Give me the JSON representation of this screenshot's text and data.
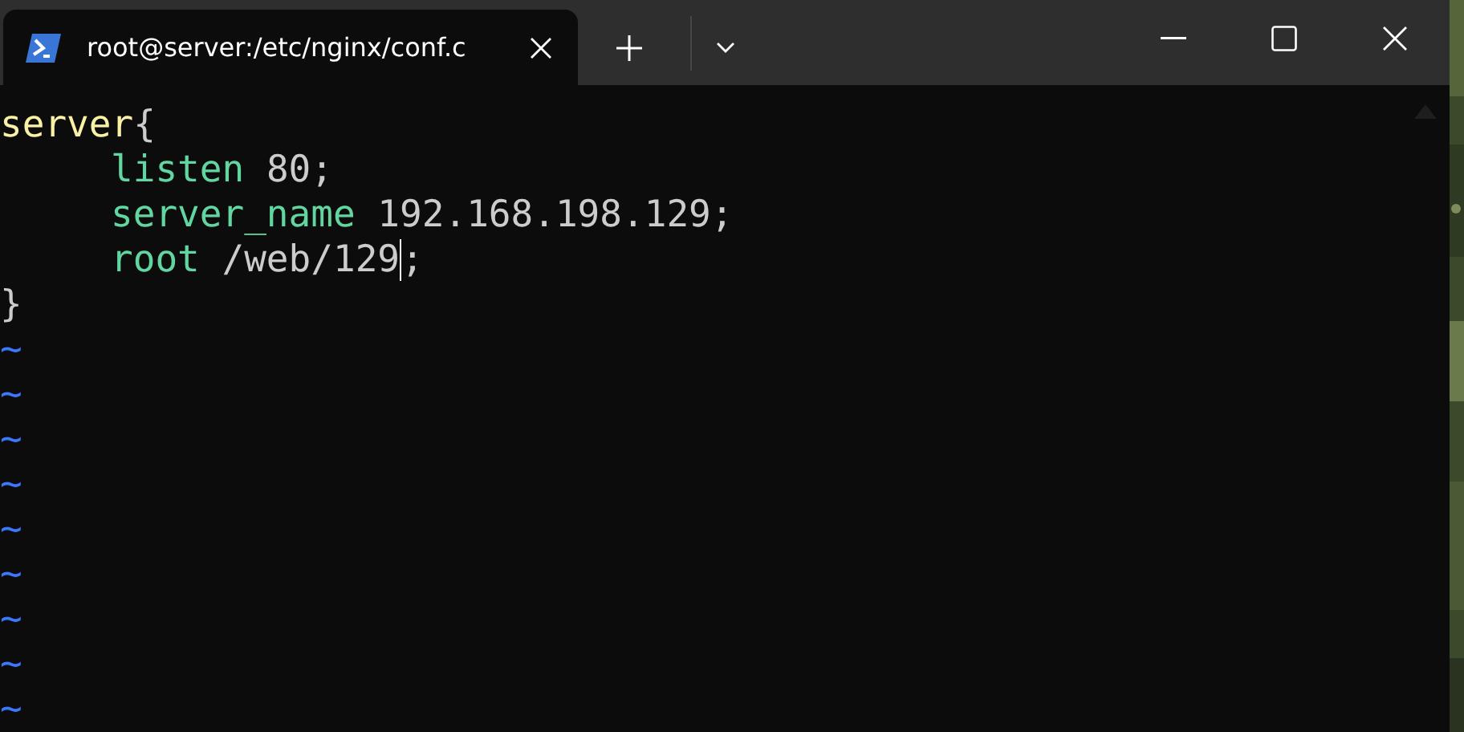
{
  "tab": {
    "title": "root@server:/etc/nginx/conf.c",
    "selected": true
  },
  "editor": {
    "blocks": [
      {
        "name": "server",
        "open": "{",
        "close": "}",
        "children": [
          [
            {
              "kind": "directive",
              "text": "listen"
            },
            {
              "kind": "plain",
              "text": " 80;"
            }
          ],
          [
            {
              "kind": "directive",
              "text": "server_name"
            },
            {
              "kind": "plain",
              "text": " 192.168.198.129;"
            }
          ],
          [
            {
              "kind": "directive",
              "text": "root"
            },
            {
              "kind": "plain",
              "text": " /web/129"
            },
            {
              "kind": "plain",
              "text": ";",
              "cursor": true
            }
          ]
        ]
      }
    ],
    "tildes": [
      "~",
      "~",
      "~",
      "~",
      "~",
      "~",
      "~",
      "~",
      "~"
    ]
  }
}
